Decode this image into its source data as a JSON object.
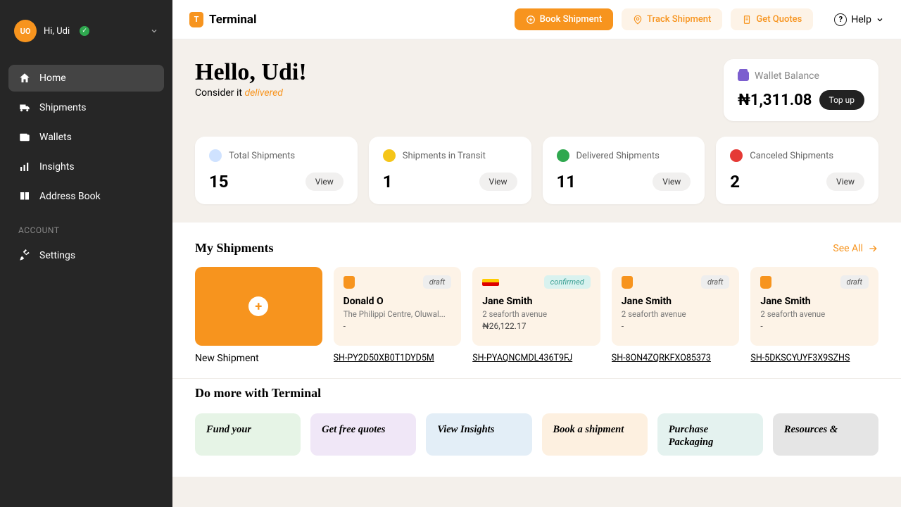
{
  "user": {
    "initials": "UO",
    "greet": "Hi, Udi"
  },
  "nav": {
    "items": [
      "Home",
      "Shipments",
      "Wallets",
      "Insights",
      "Address Book"
    ],
    "section": "ACCOUNT",
    "settings": "Settings"
  },
  "brand": {
    "letter": "T",
    "name": "Terminal"
  },
  "topbar": {
    "book": "Book Shipment",
    "track": "Track Shipment",
    "quotes": "Get Quotes",
    "help": "Help"
  },
  "hero": {
    "title": "Hello, Udi!",
    "tag1": "Consider it ",
    "tag2": "delivered"
  },
  "wallet": {
    "label": "Wallet Balance",
    "value": "₦1,311.08",
    "topup": "Top up"
  },
  "stats": [
    {
      "label": "Total Shipments",
      "value": "15",
      "view": "View"
    },
    {
      "label": "Shipments in Transit",
      "value": "1",
      "view": "View"
    },
    {
      "label": "Delivered Shipments",
      "value": "11",
      "view": "View"
    },
    {
      "label": "Canceled Shipments",
      "value": "2",
      "view": "View"
    }
  ],
  "myship": {
    "title": "My Shipments",
    "seeall": "See All",
    "new": "New Shipment"
  },
  "ships": [
    {
      "status": "draft",
      "name": "Donald O",
      "addr": "The Philippi Centre, Oluwal...",
      "amt": "-",
      "id": "SH-PY2D50XB0T1DYD5M"
    },
    {
      "status": "confirmed",
      "name": "Jane Smith",
      "addr": "2 seaforth avenue",
      "amt": "₦26,122.17",
      "id": "SH-PYAQNCMDL436T9FJ"
    },
    {
      "status": "draft",
      "name": "Jane Smith",
      "addr": "2 seaforth avenue",
      "amt": "-",
      "id": "SH-8ON4ZQRKFXO85373"
    },
    {
      "status": "draft",
      "name": "Jane Smith",
      "addr": "2 seaforth avenue",
      "amt": "-",
      "id": "SH-5DKSCYUYF3X9SZHS"
    }
  ],
  "more": {
    "title": "Do more with Terminal",
    "cards": [
      "Fund your",
      "Get free quotes",
      "View Insights",
      "Book a shipment",
      "Purchase Packaging",
      "Resources &"
    ]
  }
}
